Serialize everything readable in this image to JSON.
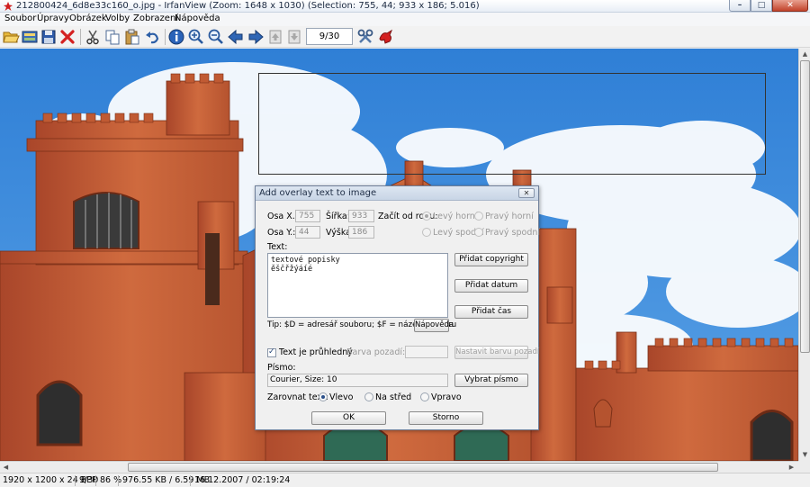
{
  "window": {
    "title": "212800424_6d8e33c160_o.jpg - IrfanView (Zoom: 1648 x 1030) (Selection: 755, 44; 933 x 186; 5.016)",
    "controls": {
      "minimize": "–",
      "maximize": "□",
      "close": "✕"
    }
  },
  "menu": [
    "Soubor",
    "Úpravy",
    "Obrázek",
    "Volby",
    "Zobrazení",
    "Nápověda"
  ],
  "toolbar": {
    "buttons": [
      "open-icon",
      "thumbnails-icon",
      "save-icon",
      "delete-icon",
      "cut-icon",
      "copy-icon",
      "paste-icon",
      "undo-icon",
      "info-icon",
      "zoom-in-icon",
      "zoom-out-icon",
      "previous-icon",
      "next-icon",
      "first-page-icon",
      "last-page-icon",
      "settings-icon",
      "irfanview-icon"
    ],
    "page_indicator": "9/30"
  },
  "status": {
    "dimensions": "1920 x 1200 x 24 BPP",
    "index": "9/30",
    "zoom": "86 %",
    "filesize": "976.55 KB / 6.59 MB",
    "datetime": "16.12.2007 / 02:19:24"
  },
  "dialog": {
    "title": "Add overlay text to image",
    "close": "✕",
    "osa_x_label": "Osa X.:",
    "osa_x_value": "755",
    "sirka_label": "Šířka:",
    "sirka_value": "933",
    "osa_y_label": "Osa Y.:",
    "osa_y_value": "44",
    "vyska_label": "Výška:",
    "vyska_value": "186",
    "corner_label": "Začít od rohu:",
    "corner_options": [
      "Levý horní",
      "Pravý horní",
      "Levý spodní",
      "Pravý spodní"
    ],
    "corner_selected": "Levý horní",
    "text_label": "Text:",
    "text_lines": [
      "textové popisky",
      "ěščřžýáíé"
    ],
    "btn_copyright": "Přidat copyright",
    "btn_date": "Přidat datum",
    "btn_time": "Přidat čas",
    "tip": "Tip: $D = adresář souboru; $F = název souboru",
    "btn_help": "Nápověda",
    "transparent_label": "Text je průhledný",
    "transparent_checked": true,
    "bg_color_label": "Barva pozadí:",
    "btn_bg_color": "Nastavit barvu pozadí",
    "font_label": "Písmo:",
    "font_value": "Courier, Size: 10",
    "btn_font": "Vybrat písmo",
    "align_label": "Zarovnat text:",
    "align_options": [
      "Vlevo",
      "Na střed",
      "Vpravo"
    ],
    "align_selected": "Vlevo",
    "btn_ok": "OK",
    "btn_cancel": "Storno"
  },
  "colors": {
    "sky": "#3f86d4",
    "brick": "#c45a33",
    "accent_red": "#d01f1f"
  }
}
